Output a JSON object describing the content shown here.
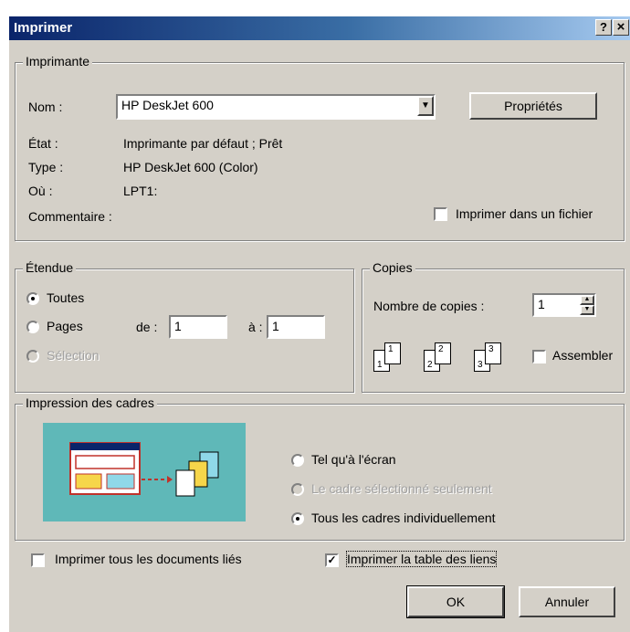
{
  "window": {
    "title": "Imprimer",
    "help_icon": "?",
    "close_icon": "×"
  },
  "printer": {
    "group_label": "Imprimante",
    "name_label": "Nom :",
    "name_value": "HP DeskJet 600",
    "properties_button": "Propriétés",
    "state_label": "État :",
    "state_value": "Imprimante par défaut ; Prêt",
    "type_label": "Type :",
    "type_value": "HP DeskJet 600 (Color)",
    "where_label": "Où :",
    "where_value": "LPT1:",
    "comment_label": "Commentaire :",
    "print_to_file_label": "Imprimer dans un fichier",
    "print_to_file_checked": false
  },
  "range": {
    "group_label": "Étendue",
    "all_label": "Toutes",
    "pages_label": "Pages",
    "from_label": "de :",
    "from_value": "1",
    "to_label": "à :",
    "to_value": "1",
    "selection_label": "Sélection",
    "selected": "all"
  },
  "copies": {
    "group_label": "Copies",
    "count_label": "Nombre de copies :",
    "count_value": "1",
    "collate_label": "Assembler",
    "collate_checked": false
  },
  "frames": {
    "group_label": "Impression des cadres",
    "as_screen_label": "Tel qu'à l'écran",
    "selected_frame_label": "Le cadre sélectionné seulement",
    "all_individually_label": "Tous les cadres individuellement",
    "selected": "all_individually"
  },
  "options": {
    "print_linked_label": "Imprimer tous les documents liés",
    "print_linked_checked": false,
    "print_links_table_label": "Imprimer la table des liens",
    "print_links_table_checked": true
  },
  "buttons": {
    "ok": "OK",
    "cancel": "Annuler"
  },
  "icons": {
    "dropdown": "chevron-down-icon",
    "spinner": "spinner-arrows-icon"
  }
}
